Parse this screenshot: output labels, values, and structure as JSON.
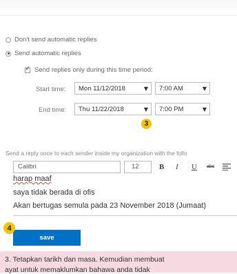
{
  "options": {
    "dont_send_label": "Don't send automatic replies",
    "send_label": "Send automatic replies",
    "period_checkbox_label": "Send replies only during this time period:"
  },
  "schedule": {
    "start_label": "Start time:",
    "start_date": "Mon 11/12/2018",
    "start_time": "7:00 AM",
    "end_label": "End time:",
    "end_date": "Thu 11/22/2018",
    "end_time": "7:00 PM"
  },
  "reply": {
    "note": "Send a reply once to each sender inside my organization with the follo",
    "font": "Calibri",
    "size": "12",
    "bold_label": "B",
    "italic_label": "I",
    "underline_label": "U",
    "strike_label": "abc",
    "lines": [
      "harap maaf",
      "saya tidak berada di ofis",
      "Akan bertugas semula pada 23 November 2018 (Jumaat)"
    ]
  },
  "save_label": "save",
  "badges": {
    "step3": "3",
    "step4": "4"
  },
  "caption": {
    "line1": "3. Tetapkan tarikh dan masa. Kemudian membuat",
    "line2": "ayat untuk memaklumkan bahawa anda tidak"
  },
  "colors": {
    "accent": "#0072c6",
    "badge": "#f7c300",
    "caption_bg": "#f7d9e1"
  },
  "icons": [
    "radio-icon",
    "checkbox-icon",
    "dropdown-caret-icon",
    "align-icon"
  ]
}
